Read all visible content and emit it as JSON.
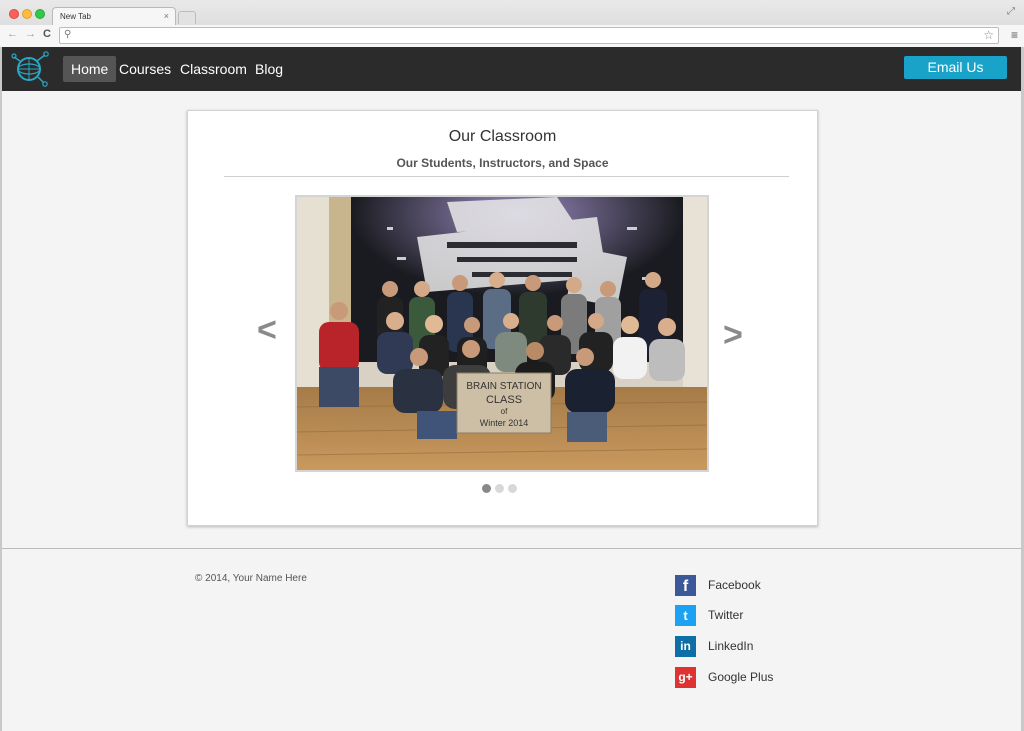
{
  "browser": {
    "tab_title": "New Tab",
    "tab_close": "×",
    "back": "←",
    "forward": "→",
    "reload": "C"
  },
  "nav": {
    "links": [
      {
        "label": "Home",
        "active": true
      },
      {
        "label": "Courses"
      },
      {
        "label": "Classroom"
      },
      {
        "label": "Blog"
      }
    ],
    "email_button": "Email Us"
  },
  "card": {
    "title": "Our Classroom",
    "subtitle": "Our Students, Instructors, and Space",
    "prev": "<",
    "next": ">",
    "slides": 3,
    "active_slide": 1,
    "sign_text": [
      "BRAIN STATION",
      "CLASS",
      "of",
      "Winter 2014"
    ]
  },
  "footer": {
    "copyright": "© 2014, Your Name Here",
    "social": [
      {
        "label": "Facebook",
        "glyph": "f",
        "color": "#3b5998"
      },
      {
        "label": "Twitter",
        "glyph": "t",
        "color": "#1da1f2"
      },
      {
        "label": "LinkedIn",
        "glyph": "in",
        "color": "#0e6fa6"
      },
      {
        "label": "Google Plus",
        "glyph": "g+",
        "color": "#dd3333"
      }
    ]
  },
  "colors": {
    "accent": "#1aa3c8",
    "nav_bg": "#2b2b2b"
  }
}
